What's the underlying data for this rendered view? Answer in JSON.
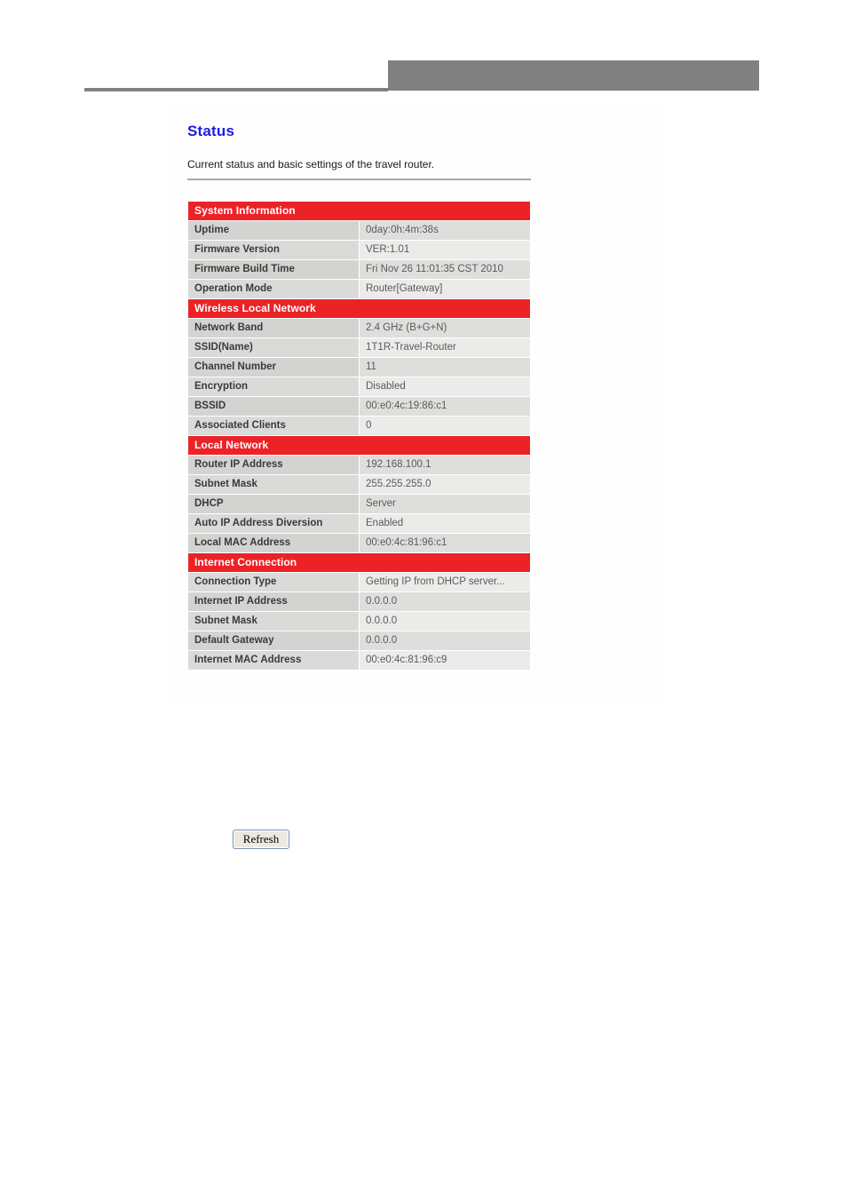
{
  "header": {
    "banner_color": "#808080",
    "rule_color": "#808080"
  },
  "page": {
    "title": "Status",
    "description": "Current status and basic settings of the travel router.",
    "title_color": "#1c1ce0",
    "section_header_color": "#ec2227"
  },
  "sections": [
    {
      "title": "System Information",
      "rows": [
        {
          "label": "Uptime",
          "value": "0day:0h:4m:38s"
        },
        {
          "label": "Firmware Version",
          "value": "VER:1.01"
        },
        {
          "label": "Firmware Build Time",
          "value": "Fri Nov 26 11:01:35 CST 2010"
        },
        {
          "label": "Operation Mode",
          "value": "Router[Gateway]"
        }
      ]
    },
    {
      "title": "Wireless Local Network",
      "rows": [
        {
          "label": "Network Band",
          "value": "2.4 GHz (B+G+N)"
        },
        {
          "label": "SSID(Name)",
          "value": "1T1R-Travel-Router"
        },
        {
          "label": "Channel Number",
          "value": "11"
        },
        {
          "label": "Encryption",
          "value": "Disabled"
        },
        {
          "label": "BSSID",
          "value": "00:e0:4c:19:86:c1"
        },
        {
          "label": "Associated Clients",
          "value": "0"
        }
      ]
    },
    {
      "title": "Local Network",
      "rows": [
        {
          "label": "Router IP Address",
          "value": "192.168.100.1"
        },
        {
          "label": "Subnet Mask",
          "value": "255.255.255.0"
        },
        {
          "label": "DHCP",
          "value": "Server"
        },
        {
          "label": "Auto IP Address Diversion",
          "value": "Enabled"
        },
        {
          "label": "Local MAC Address",
          "value": "00:e0:4c:81:96:c1"
        }
      ]
    },
    {
      "title": "Internet Connection",
      "rows": [
        {
          "label": "Connection Type",
          "value": "Getting IP from DHCP server..."
        },
        {
          "label": "Internet IP Address",
          "value": "0.0.0.0"
        },
        {
          "label": "Subnet Mask",
          "value": "0.0.0.0"
        },
        {
          "label": "Default Gateway",
          "value": "0.0.0.0"
        },
        {
          "label": "Internet MAC Address",
          "value": "00:e0:4c:81:96:c9"
        }
      ]
    }
  ],
  "actions": {
    "refresh_label": "Refresh"
  }
}
